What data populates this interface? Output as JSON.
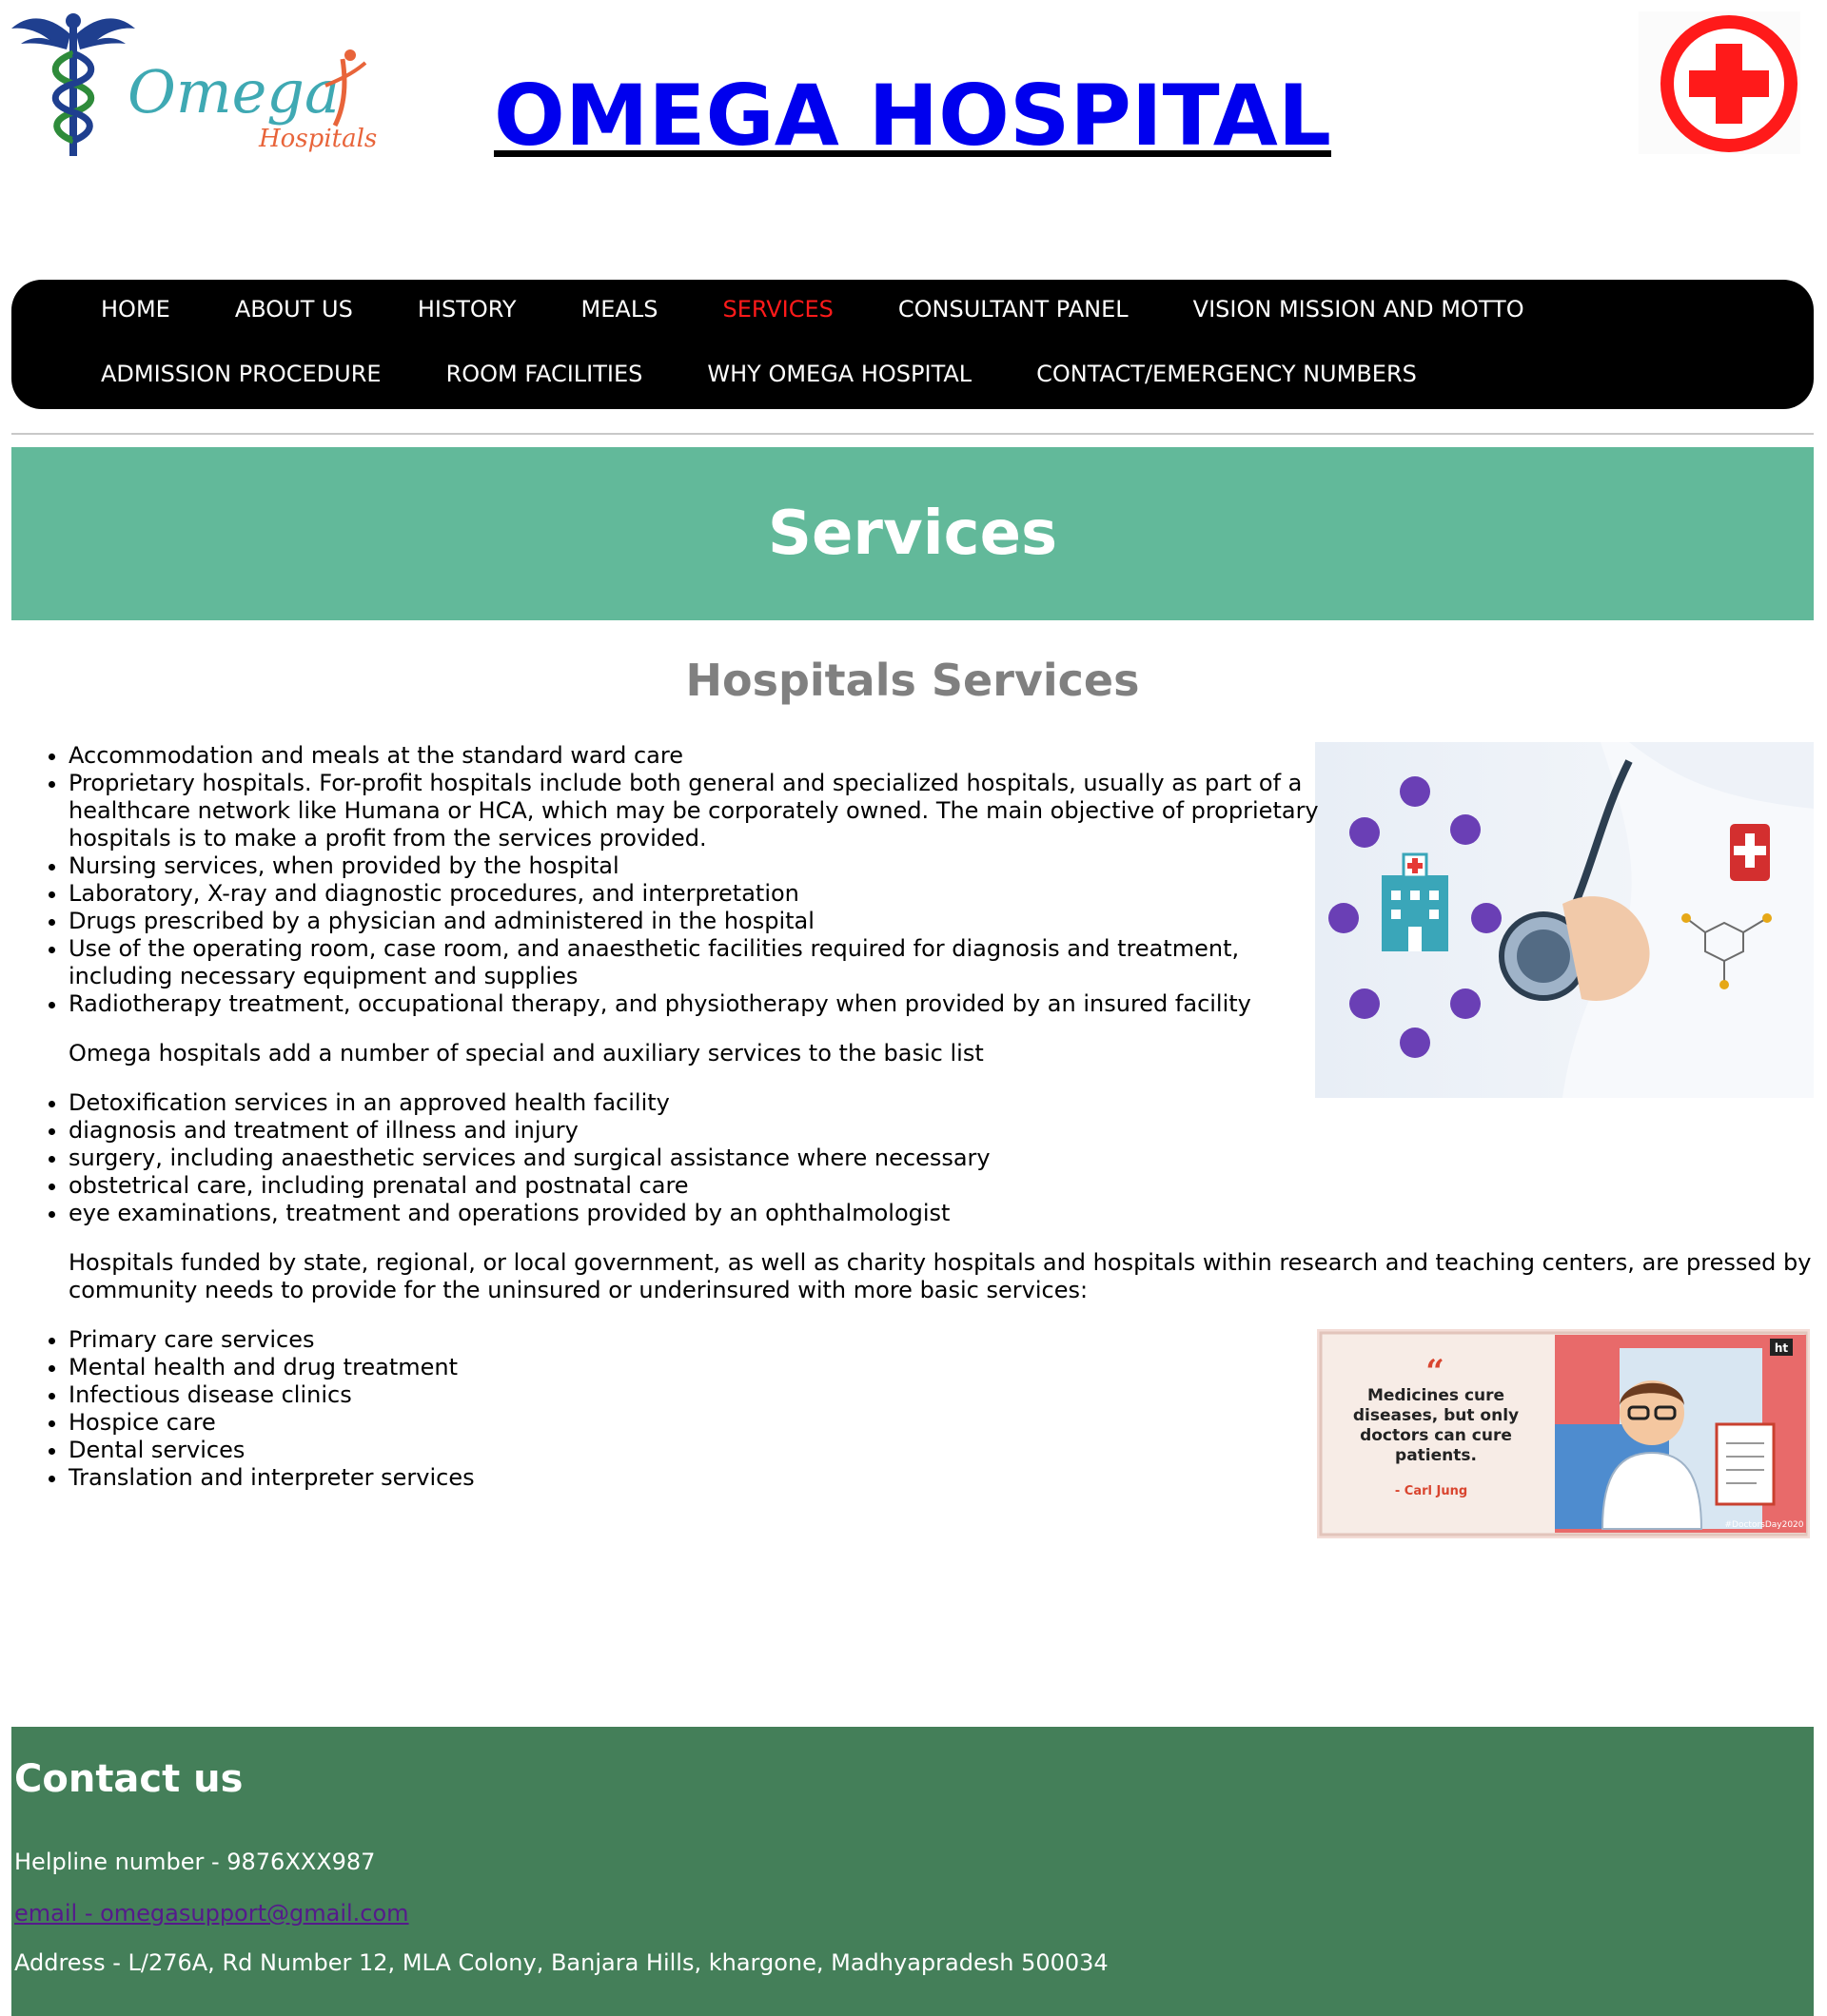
{
  "header": {
    "logo_text": "Omega",
    "logo_subtext": "Hospitals",
    "title": "OMEGA HOSPITAL"
  },
  "nav": {
    "row1": [
      "HOME",
      "ABOUT US",
      "HISTORY",
      "MEALS",
      "SERVICES",
      "CONSULTANT PANEL",
      "VISION MISSION AND MOTTO"
    ],
    "row2": [
      "ADMISSION PROCEDURE",
      "ROOM FACILITIES",
      "WHY OMEGA HOSPITAL",
      "CONTACT/EMERGENCY NUMBERS"
    ],
    "active": "SERVICES",
    "active_color": "#ff1a1a"
  },
  "banner": {
    "title": "Services",
    "color": "#62b99a"
  },
  "main": {
    "heading": "Hospitals Services",
    "list1": [
      "Accommodation and meals at the standard ward care",
      "Proprietary hospitals. For-profit hospitals include both general and specialized hospitals, usually as part of a healthcare network like Humana or HCA, which may be corporately owned. The main objective of proprietary hospitals is to make a profit from the services provided.",
      "Nursing services, when provided by the hospital",
      "Laboratory, X-ray and diagnostic procedures, and interpretation",
      "Drugs prescribed by a physician and administered in the hospital",
      "Use of the operating room, case room, and anaesthetic facilities required for diagnosis and treatment, including necessary equipment and supplies",
      "Radiotherapy treatment, occupational therapy, and physiotherapy when provided by an insured facility"
    ],
    "para1": "Omega hospitals add a number of special and auxiliary services to the basic list",
    "list2": [
      "Detoxification services in an approved health facility",
      "diagnosis and treatment of illness and injury",
      "surgery, including anaesthetic services and surgical assistance where necessary",
      "obstetrical care, including prenatal and postnatal care",
      "eye examinations, treatment and operations provided by an ophthalmologist"
    ],
    "para2": "Hospitals funded by state, regional, or local government, as well as charity hospitals and hospitals within research and teaching centers, are pressed by community needs to provide for the uninsured or underinsured with more basic services:",
    "list3": [
      "Primary care services",
      "Mental health and drug treatment",
      "Infectious disease clinics",
      "Hospice care",
      "Dental services",
      "Translation and interpreter services"
    ],
    "quote_image": {
      "quote": "Medicines cure diseases, but only doctors can cure patients.",
      "author": "- Carl Jung",
      "tag": "#DoctorsDay2020",
      "badge": "ht"
    }
  },
  "footer": {
    "title": "Contact us",
    "helpline": "Helpline number - 9876XXX987",
    "email": "email - omegasupport@gmail.com",
    "address": "Address - L/276A, Rd Number 12, MLA Colony, Banjara Hills, khargone, Madhyapradesh 500034",
    "color": "#447f59"
  }
}
